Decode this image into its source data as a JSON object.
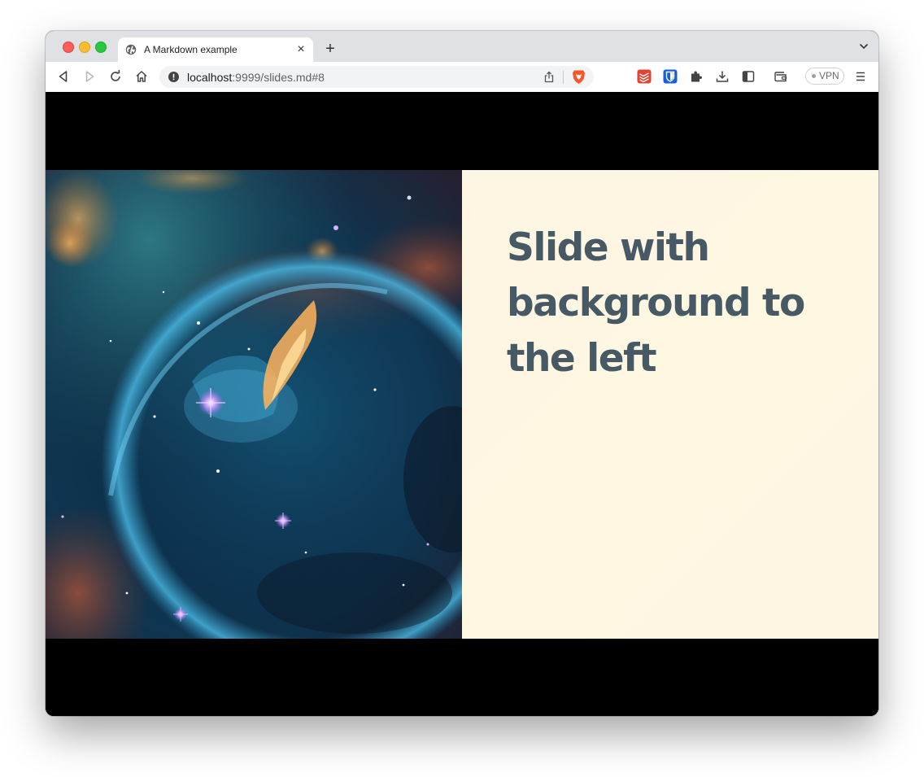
{
  "browser": {
    "tab": {
      "title": "A Markdown example",
      "favicon": "globe-icon",
      "close_icon": "close-icon"
    },
    "new_tab_icon": "plus-icon",
    "tab_list_icon": "chevron-down-icon",
    "toolbar": {
      "back_icon": "back-arrow-icon",
      "forward_icon": "forward-arrow-icon",
      "reload_icon": "reload-icon",
      "home_icon": "home-icon",
      "url": {
        "host": "localhost",
        "rest": ":9999/slides.md#8"
      },
      "security_icon": "info-icon",
      "share_icon": "share-icon",
      "brave_shields_icon": "brave-lion-icon",
      "extensions": [
        "todoist-icon",
        "bitwarden-icon",
        "puzzle-extensions-icon",
        "download-icon",
        "sidebar-icon",
        "wallet-icon"
      ],
      "vpn_label": "VPN",
      "menu_icon": "hamburger-menu-icon"
    }
  },
  "slide": {
    "background_image": "bubble-nebula-image",
    "heading": "Slide with background to the left",
    "colors": {
      "panel": "#fdf6e3",
      "heading": "#475965",
      "letterbox": "#000000"
    }
  }
}
